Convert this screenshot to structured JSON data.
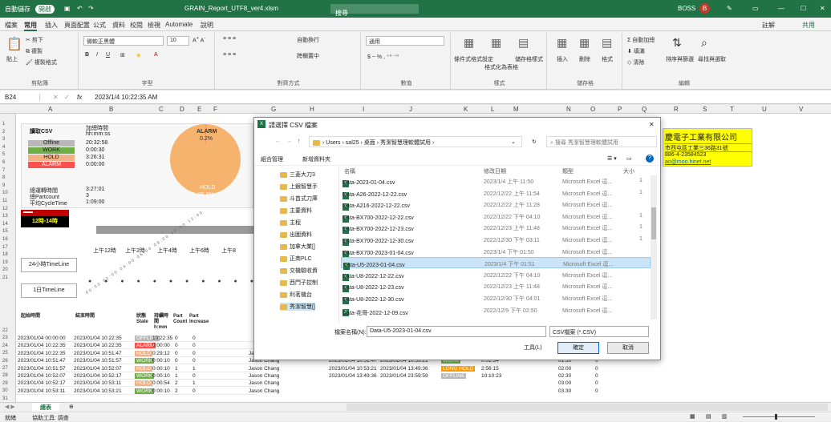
{
  "titlebar": {
    "autosave": "自動儲存",
    "toggle": "開啟",
    "filename": "GRAIN_Report_UTF8_ver4.xlsm",
    "search": "搜尋",
    "user": "BOSS",
    "avatar": "B"
  },
  "menu": {
    "items": [
      "檔案",
      "常用",
      "插入",
      "頁面配置",
      "公式",
      "資料",
      "校閱",
      "檢視",
      "Automate",
      "說明"
    ],
    "active": 1,
    "comments": "註解",
    "share": "共用"
  },
  "ribbon": {
    "clipboard": {
      "label": "剪貼簿",
      "paste": "貼上",
      "cut": "剪下",
      "copy": "複製",
      "painter": "複製格式"
    },
    "font": {
      "label": "字型",
      "name": "微軟正黑體",
      "size": "10"
    },
    "align": {
      "label": "對齊方式",
      "wrap": "自動換行",
      "merge": "跨欄置中"
    },
    "number": {
      "label": "數值",
      "format": "通用"
    },
    "styles": {
      "label": "樣式",
      "cond": "條件式格式設定",
      "table": "格式化為表格",
      "cell": "儲存格樣式"
    },
    "cells": {
      "label": "儲存格",
      "insert": "插入",
      "delete": "刪除",
      "format": "格式"
    },
    "edit": {
      "label": "編輯",
      "autosum": "自動加總",
      "fill": "填滿",
      "clear": "清除",
      "sort": "排序與篩選",
      "find": "尋找與選取"
    }
  },
  "formula": {
    "cell": "B24",
    "fx": "fx",
    "value": "2023/1/4 10:22:35 AM"
  },
  "columns": [
    "A",
    "B",
    "C",
    "D",
    "E",
    "F",
    "G",
    "H",
    "I",
    "J",
    "K",
    "L",
    "M",
    "N",
    "O",
    "P",
    "Q",
    "R",
    "S",
    "T",
    "U",
    "V"
  ],
  "rows": [
    "1",
    "2",
    "3",
    "4",
    "5",
    "6",
    "7",
    "8",
    "9",
    "10",
    "11",
    "12",
    "13",
    "14",
    "15",
    "16",
    "17",
    "18",
    "19",
    "20",
    "21",
    "22",
    "23",
    "24",
    "25",
    "26",
    "27",
    "28",
    "29",
    "30",
    "31"
  ],
  "dash": {
    "csv_title": "讀取CSV",
    "time_title": "加總時間",
    "unit": "hh:mm:ss",
    "states": [
      {
        "name": "Offline",
        "value": "20:32:58",
        "color": "#b8b8b8"
      },
      {
        "name": "WORK",
        "value": "0:00:30",
        "color": "#70ad47"
      },
      {
        "name": "HOLD",
        "value": "3:26:31",
        "color": "#f4b084"
      },
      {
        "name": "ALARM",
        "value": "0:00:00",
        "color": "#ff5050"
      }
    ],
    "run_time_label": "總運轉時間",
    "run_time": "3:27:01",
    "part_label": "總Partcount",
    "part": "3",
    "cycle_label": "平均CycleTime",
    "cycle": "1:09:00",
    "pie_alarm": "ALARM",
    "pie_alarm_pct": "0.2%",
    "pie_hold": "HOLD",
    "pie_hold_pct": "99.8%",
    "pie_alarm_share": 0.2,
    "range_label": "區間時間",
    "range": "12時-14時",
    "btn24": "24小時TimeLine",
    "btn1": "1日TimeLine",
    "timeline": [
      "上午12時",
      "上午2時",
      "上午4時",
      "上午6時",
      "上午8"
    ]
  },
  "table": {
    "headers": [
      "起始時間",
      "結束時間",
      "狀態 State",
      "持續時間 h:mm",
      "Part Count",
      "Part Increase"
    ],
    "rows": [
      [
        "2023/01/04 00:00:00",
        "2023/01/04 10:22:35",
        "OFFLINE",
        "10:22:35",
        "0",
        "0"
      ],
      [
        "2023/01/04 10:22:35",
        "2023/01/04 10:22:35",
        "ALARM",
        "0:00:00",
        "0",
        "0"
      ],
      [
        "2023/01/04 10:22:35",
        "2023/01/04 10:51:47",
        "HOLD",
        "0:29:12",
        "0",
        "0"
      ],
      [
        "2023/01/04 10:51:47",
        "2023/01/04 10:51:57",
        "WORK",
        "0:00:10",
        "0",
        "0"
      ],
      [
        "2023/01/04 10:51:57",
        "2023/01/04 10:52:07",
        "HOLD",
        "0:00:10",
        "1",
        "1"
      ],
      [
        "2023/01/04 10:52:07",
        "2023/01/04 10:52:17",
        "WORK",
        "0:00:10",
        "1",
        "0"
      ],
      [
        "2023/01/04 10:52:17",
        "2023/01/04 10:53:11",
        "HOLD",
        "0:00:54",
        "2",
        "1"
      ],
      [
        "2023/01/04 10:53:11",
        "2023/01/04 10:53:21",
        "WORK",
        "0:00:10",
        "2",
        "0"
      ]
    ],
    "operators": [
      "",
      "",
      "Jason Chang",
      "Jason Chang",
      "Jason Chang",
      "Jason Chang",
      "Jason Chang",
      "Jason Chang"
    ],
    "right_rows": [
      [
        "2023/01/04 10:51:47",
        "2023/01/04 10:53:21",
        "WORK",
        "0:01:34"
      ],
      [
        "2023/01/04 10:53:21",
        "2023/01/04 13:49:36",
        "LONG HOLD",
        "2:56:15"
      ],
      [
        "2023/01/04 13:49:36",
        "2023/01/04 23:59:59",
        "OFFLINE",
        "10:10:23"
      ]
    ],
    "n_col": [
      "01:30",
      "02:00",
      "02:30",
      "03:00",
      "03:30"
    ],
    "o_col": [
      "0",
      "0",
      "0",
      "0",
      "0"
    ]
  },
  "company": {
    "name": "慶電子工業有限公司",
    "addr": "市西屯區工業三36路31號",
    "phone": "886-4-23584523",
    "mail": "ao@moo.hinet.net"
  },
  "dialog": {
    "title": "請選擇 CSV 檔案",
    "path": [
      "Users",
      "sal25",
      "桌面",
      "秀潔智慧理軟體試用"
    ],
    "search": "搜尋 秀潔智慧理軟體試用",
    "organize": "組合管理",
    "newfolder": "新增資料夾",
    "nav": [
      "三菱大刀3",
      "上銀智慧手",
      "斗首式刀庫",
      "主要資料",
      "主程",
      "出圖資料",
      "加拿大業[]",
      "正商PLC",
      "交機驗收資",
      "西門子控制",
      "利茗機台",
      "秀潔智慧[]"
    ],
    "cols": [
      "名稱",
      "修改日期",
      "類型",
      "大小"
    ],
    "files": [
      [
        "Data-2023-01-04.csv",
        "2023/1/4 上午 11:50",
        "Microsoft Excel 逗...",
        "1"
      ],
      [
        "Data-A26-2022-12-22.csv",
        "2022/12/22 上午 11:54",
        "Microsoft Excel 逗...",
        "1"
      ],
      [
        "Data-A216-2022-12-22.csv",
        "2022/12/22 上午 11:28",
        "Microsoft Excel 逗...",
        ""
      ],
      [
        "Data-BX700-2022-12-22.csv",
        "2022/12/22 下午 04:10",
        "Microsoft Excel 逗...",
        "1"
      ],
      [
        "Data-BX700-2022-12-23.csv",
        "2022/12/23 上午 11:48",
        "Microsoft Excel 逗...",
        "1"
      ],
      [
        "Data-BX700-2022-12-30.csv",
        "2022/12/30 下午 03:11",
        "Microsoft Excel 逗...",
        "1"
      ],
      [
        "Data-BX700-2023-01-04.csv",
        "2023/1/4 下午 01:50",
        "Microsoft Excel 逗...",
        ""
      ],
      [
        "Data-U5-2023-01-04.csv",
        "2023/1/4 下午 01:51",
        "Microsoft Excel 逗...",
        ""
      ],
      [
        "Data-U8-2022-12-22.csv",
        "2022/12/22 下午 04:10",
        "Microsoft Excel 逗...",
        ""
      ],
      [
        "Data-U8-2022-12-23.csv",
        "2022/12/23 上午 11:48",
        "Microsoft Excel 逗...",
        ""
      ],
      [
        "Data-U8-2022-12-30.csv",
        "2022/12/30 下午 04:01",
        "Microsoft Excel 逗...",
        ""
      ],
      [
        "Data-花哥-2022-12-09.csv",
        "2022/12/9 下午 02:50",
        "Microsoft Excel 逗...",
        ""
      ]
    ],
    "selected": 7,
    "fname_label": "檔案名稱(N):",
    "fname": "Data-U5-2023-01-04.csv",
    "ftype": "CSV檔案 (*.CSV)",
    "tools": "工具(L)",
    "ok": "確定",
    "cancel": "取消"
  },
  "sheettab": "總表",
  "status": {
    "ready": "就緒",
    "access": "協助工具: 調查"
  },
  "colors": {
    "excel": "#217346",
    "work": "#70ad47",
    "hold": "#f4b084",
    "alarm": "#ff5050",
    "offline": "#b8b8b8",
    "longhold": "#ff9900"
  }
}
